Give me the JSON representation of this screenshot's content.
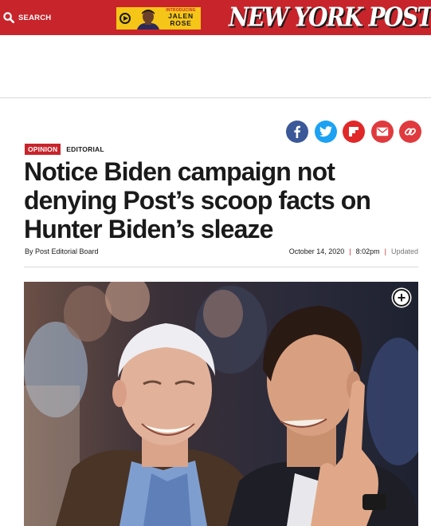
{
  "header": {
    "search_label": "SEARCH",
    "search_icon": "search-icon",
    "promo": {
      "kicker": "INTRODUCING",
      "name_line1": "JALEN",
      "name_line2": "ROSE",
      "play_icon": "play-icon"
    },
    "logo_text": "NEW YORK POST"
  },
  "share": [
    {
      "icon": "facebook-icon",
      "color": "#3b5998"
    },
    {
      "icon": "twitter-icon",
      "color": "#1da1f2"
    },
    {
      "icon": "flipboard-icon",
      "color": "#e12828"
    },
    {
      "icon": "email-icon",
      "color": "#e03a3e"
    },
    {
      "icon": "link-icon",
      "color": "#e03a3e"
    }
  ],
  "article": {
    "badge": "OPINION",
    "section": "EDITORIAL",
    "headline": "Notice Biden campaign not denying Post’s scoop facts on Hunter Biden’s sleaze",
    "byline": "By Post Editorial Board",
    "date": "October 14, 2020",
    "time": "8:02pm",
    "updated": "Updated",
    "separator": "|"
  },
  "photo": {
    "expand_icon": "plus-icon",
    "expand_symbol": "+"
  },
  "colors": {
    "brand_red": "#c8242b",
    "promo_yellow": "#f5c518"
  }
}
